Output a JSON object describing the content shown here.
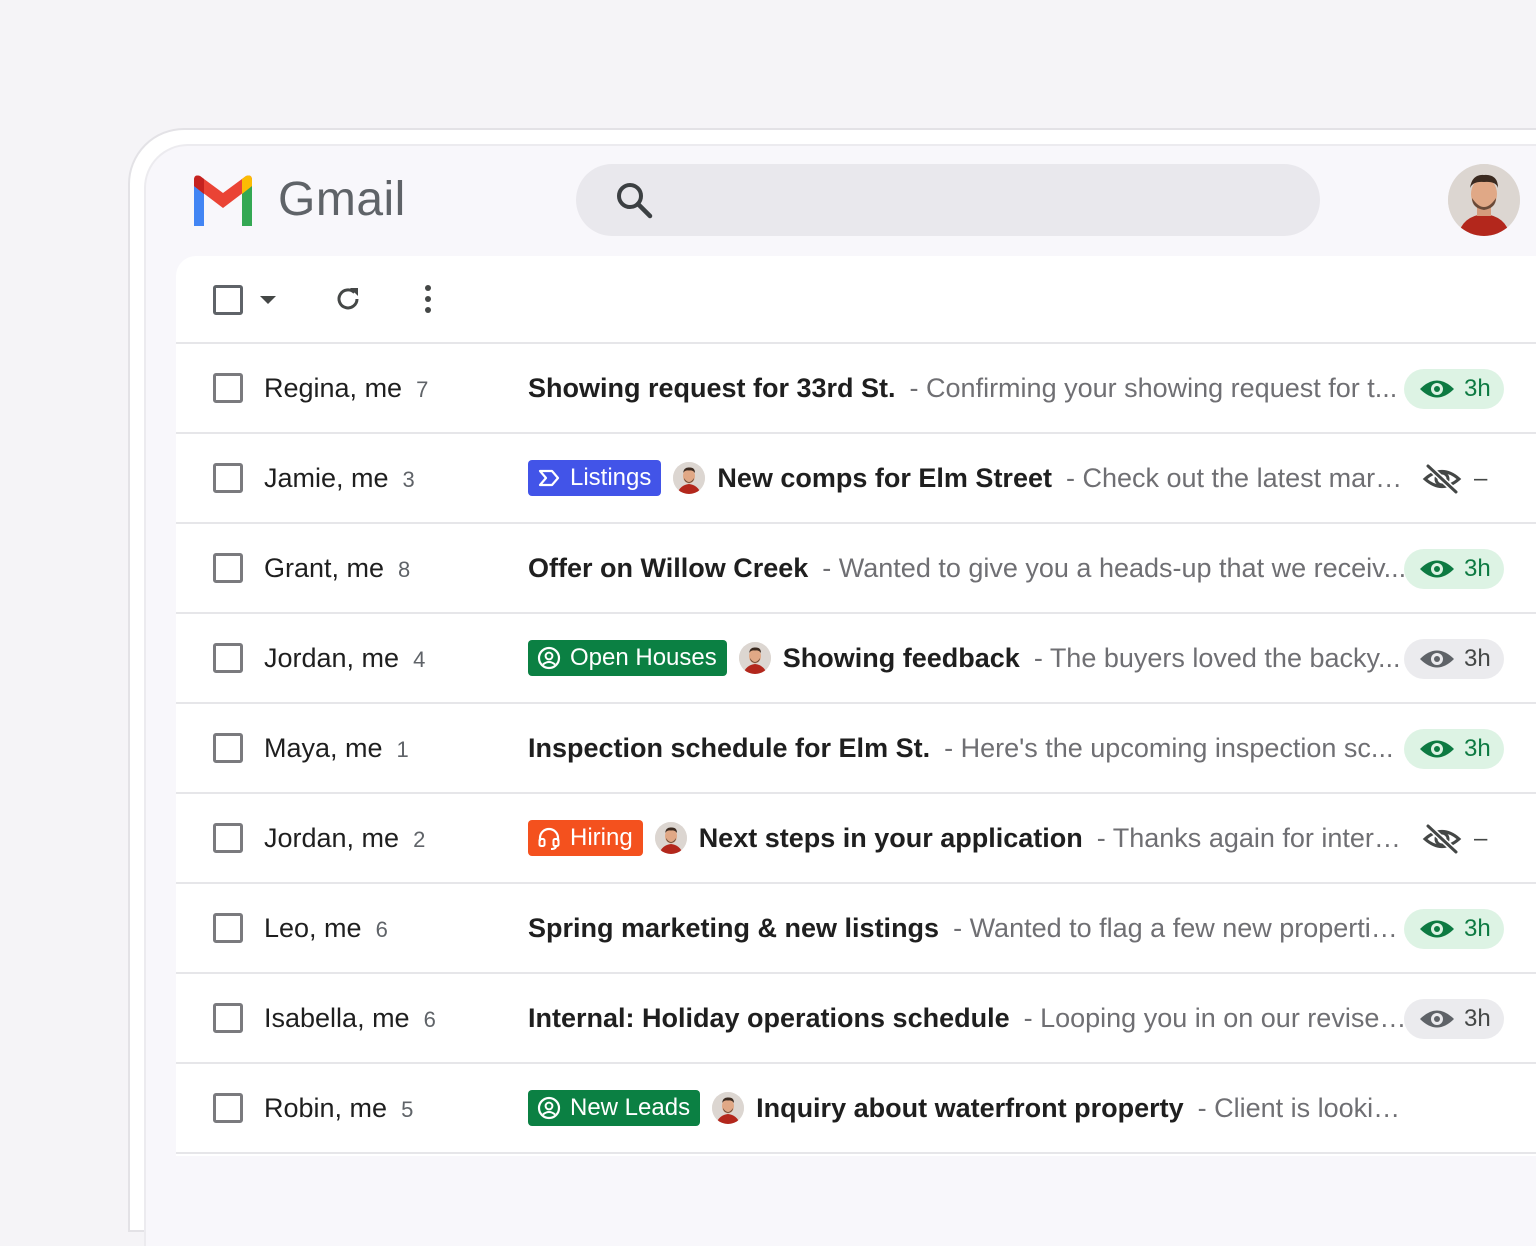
{
  "app": {
    "name": "Gmail"
  },
  "colors": {
    "listings": "#4254e8",
    "open_houses": "#0b8043",
    "hiring": "#f4511e",
    "new_leads": "#0b8043"
  },
  "rows": [
    {
      "sender": "Regina, me",
      "count": "7",
      "label": null,
      "subject": "Showing request for 33rd St.",
      "snippet": "- Confirming your showing request for t...",
      "status": "seen",
      "time": "3h"
    },
    {
      "sender": "Jamie, me",
      "count": "3",
      "label": {
        "text": "Listings",
        "icon": "label-arrow-icon",
        "color": "#4254e8"
      },
      "avatar": true,
      "subject": "New comps for Elm Street",
      "snippet": "- Check out the latest mark...",
      "status": "hidden",
      "time": "–"
    },
    {
      "sender": "Grant, me",
      "count": "8",
      "label": null,
      "subject": "Offer on Willow Creek",
      "snippet": "- Wanted to give you a heads-up that we receiv...",
      "status": "seen",
      "time": "3h"
    },
    {
      "sender": "Jordan, me",
      "count": "4",
      "label": {
        "text": "Open Houses",
        "icon": "person-circle-icon",
        "color": "#0b8043"
      },
      "avatar": true,
      "subject": "Showing feedback",
      "snippet": "- The buyers loved the backy...",
      "status": "grey",
      "time": "3h"
    },
    {
      "sender": "Maya, me",
      "count": "1",
      "label": null,
      "subject": "Inspection schedule for Elm St.",
      "snippet": "- Here's the upcoming inspection sc...",
      "status": "seen",
      "time": "3h"
    },
    {
      "sender": "Jordan, me",
      "count": "2",
      "label": {
        "text": "Hiring",
        "icon": "headset-icon",
        "color": "#f4511e"
      },
      "avatar": true,
      "subject": "Next steps in your application",
      "snippet": "- Thanks again for intervi...",
      "status": "hidden",
      "time": "–"
    },
    {
      "sender": "Leo, me",
      "count": "6",
      "label": null,
      "subject": "Spring marketing & new listings",
      "snippet": "- Wanted to flag a few new propertie...",
      "status": "seen",
      "time": "3h"
    },
    {
      "sender": "Isabella, me",
      "count": "6",
      "label": null,
      "subject": "Internal: Holiday operations schedule",
      "snippet": "- Looping you in on our revised...",
      "status": "grey",
      "time": "3h"
    },
    {
      "sender": "Robin, me",
      "count": "5",
      "label": {
        "text": "New Leads",
        "icon": "person-circle-icon",
        "color": "#0b8043"
      },
      "avatar": true,
      "subject": "Inquiry about waterfront property",
      "snippet": "- Client is looking f...",
      "status": "none",
      "time": ""
    }
  ]
}
